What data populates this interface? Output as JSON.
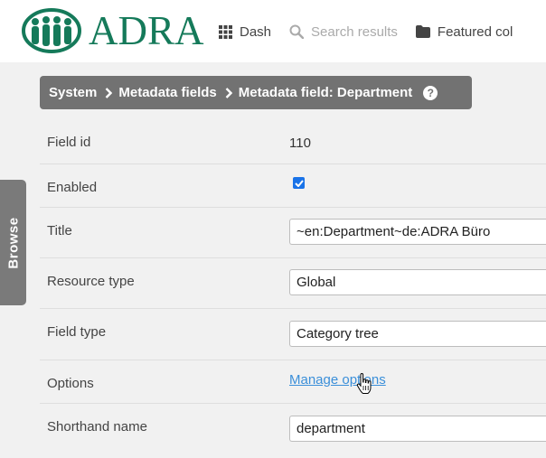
{
  "header": {
    "logo_text": "ADRA",
    "nav": [
      {
        "label": "Dash",
        "icon": "grid-icon"
      },
      {
        "label": "Search results",
        "icon": "search-icon"
      },
      {
        "label": "Featured col",
        "icon": "folder-icon"
      }
    ]
  },
  "breadcrumb": {
    "items": [
      "System",
      "Metadata fields",
      "Metadata field: Department"
    ],
    "help_icon": "?"
  },
  "browse_tab": {
    "label": "Browse"
  },
  "form": {
    "field_id": {
      "label": "Field id",
      "value": "110"
    },
    "enabled": {
      "label": "Enabled",
      "checked": true
    },
    "title": {
      "label": "Title",
      "value": "~en:Department~de:ADRA Büro"
    },
    "resource_type": {
      "label": "Resource type",
      "value": "Global"
    },
    "field_type": {
      "label": "Field type",
      "value": "Category tree"
    },
    "options": {
      "label": "Options",
      "link": "Manage options"
    },
    "shorthand": {
      "label": "Shorthand name",
      "value": "department"
    }
  },
  "colors": {
    "brand": "#157a5a",
    "breadcrumb_bg": "#727272",
    "link": "#3b8fd9",
    "checkbox": "#1a73e8"
  }
}
